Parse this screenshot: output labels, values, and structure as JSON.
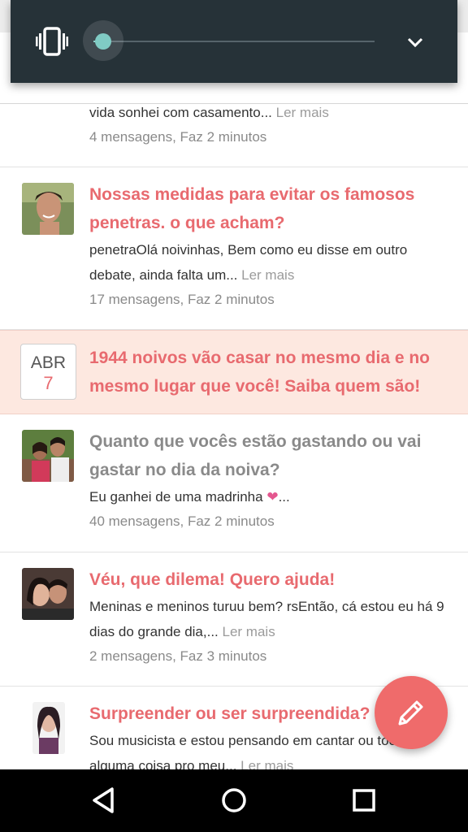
{
  "volume": {
    "level": 0.0,
    "accent": "#80cbc4",
    "panel_color": "#263238",
    "mode_icon": "vibrate-icon",
    "expand_icon": "chevron-down-icon"
  },
  "feed": {
    "items": [
      {
        "type": "partial",
        "excerpt": "vida sonhei com casamento...",
        "more": "Ler mais",
        "meta": "4 mensagens, Faz 2 minutos"
      },
      {
        "type": "post",
        "title": "Nossas medidas para evitar os famosos penetras. o que acham?",
        "excerpt": "penetraOlá noivinhas, Bem como eu disse em outro debate, ainda falta um...",
        "more": "Ler mais",
        "meta": "17 mensagens, Faz 2 minutos"
      },
      {
        "type": "event",
        "month": "ABR",
        "day": "7",
        "title": "1944 noivos vão casar no mesmo dia e no mesmo lugar que você! Saiba quem são!"
      },
      {
        "type": "post",
        "title": "Quanto que vocês estão gastando ou vai gastar no dia da noiva?",
        "excerpt": "Eu ganhei de uma madrinha",
        "excerpt_heart": "❤",
        "excerpt_tail": "...",
        "meta": "40 mensagens, Faz 2 minutos"
      },
      {
        "type": "post",
        "title": "Véu, que dilema! Quero ajuda!",
        "excerpt": "Meninas e meninos turuu bem? rsEntão, cá estou eu há 9 dias do grande dia,...",
        "more": "Ler mais",
        "meta": "2 mensagens, Faz 3 minutos"
      },
      {
        "type": "post",
        "title": "Surpreender ou ser surpreendida?",
        "excerpt": "Sou musicista e estou pensando em cantar ou tocar alguma coisa pro meu...",
        "more": "Ler mais"
      }
    ]
  },
  "fab": {
    "icon": "pencil-icon",
    "color": "#ef6b6b"
  },
  "navbar": {
    "back_icon": "back-icon",
    "home_icon": "home-icon",
    "recents_icon": "recents-icon"
  },
  "colors": {
    "title": "#e86a6f",
    "muted": "#8a8a8a",
    "event_bg": "#fde8e0"
  }
}
